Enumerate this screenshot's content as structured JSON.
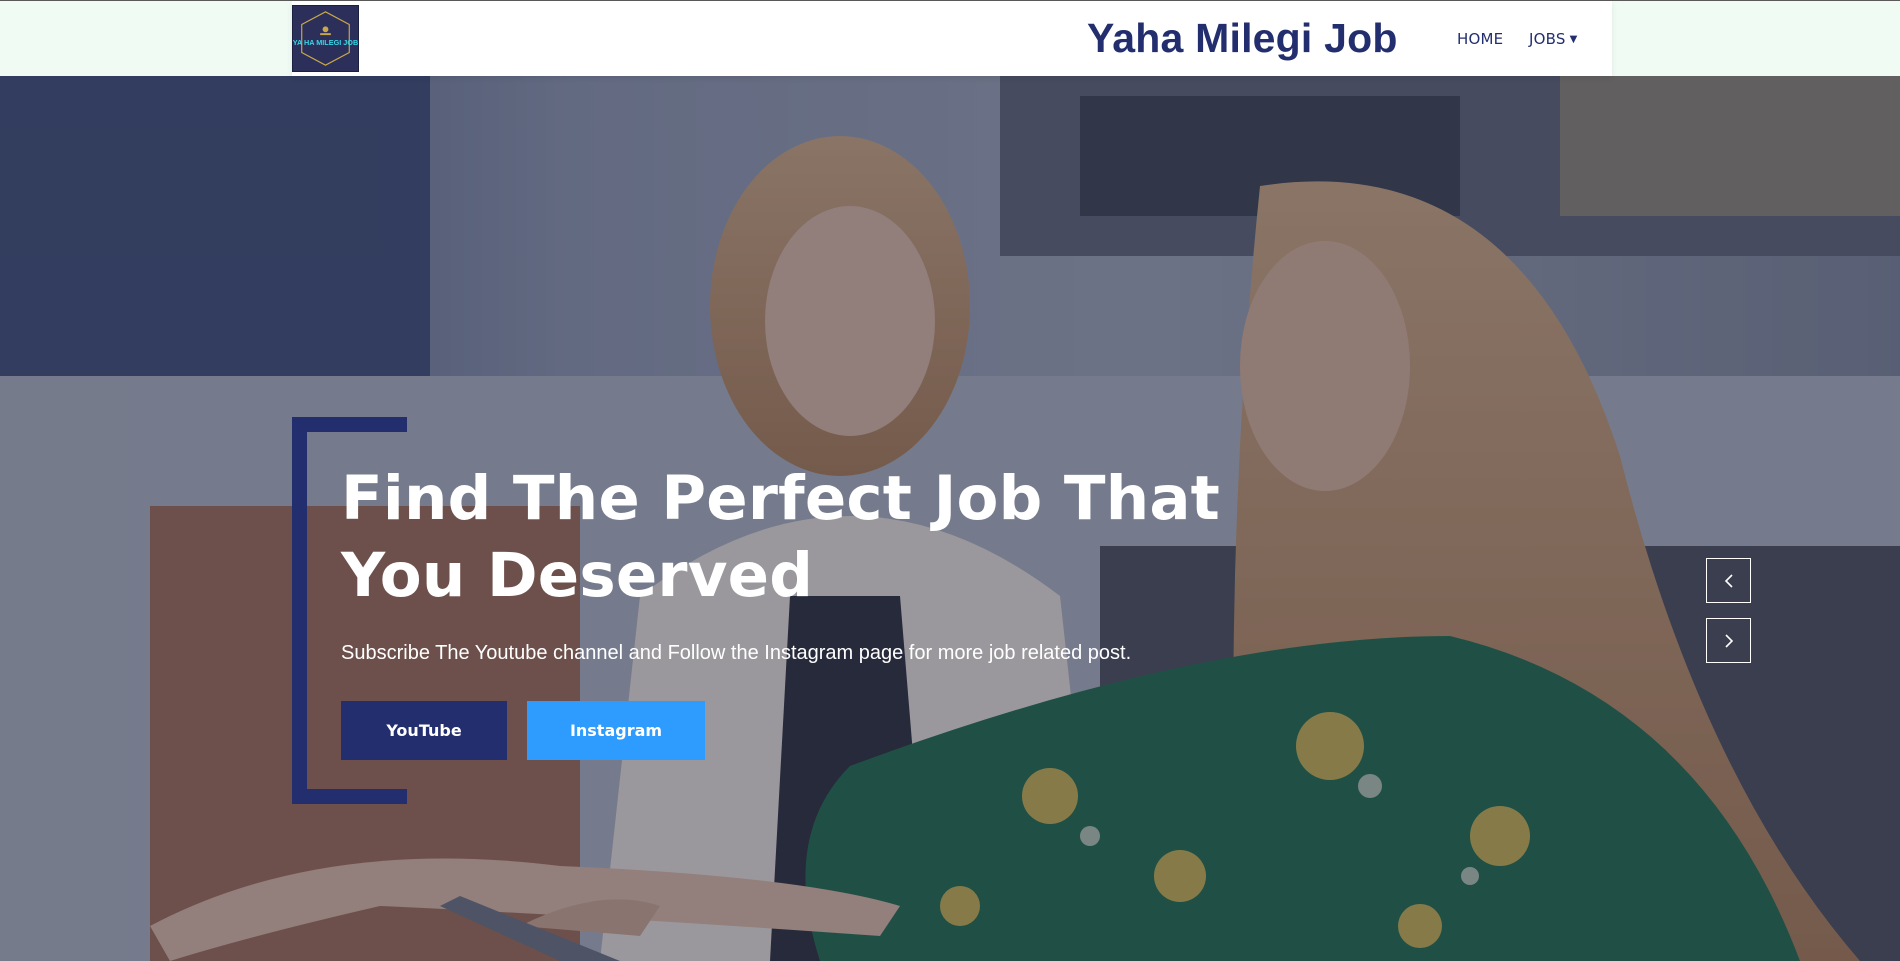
{
  "header": {
    "logo_text": "YA HA MILEGI JOB",
    "brand": "Yaha Milegi Job",
    "nav": {
      "home": "HOME",
      "jobs": "JOBS"
    }
  },
  "hero": {
    "title_line1": "Find The Perfect Job That",
    "title_line2": "You Deserved",
    "subtitle": "Subscribe The Youtube channel and Follow the Instagram page for more job related post.",
    "buttons": {
      "youtube": "YouTube",
      "instagram": "Instagram"
    },
    "icons": {
      "prev": "chevron-left-icon",
      "next": "chevron-right-icon",
      "dropdown": "chevron-down-icon"
    }
  },
  "colors": {
    "primary": "#232e6e",
    "accent": "#2e9bff",
    "strip": "#f0fbf4"
  }
}
